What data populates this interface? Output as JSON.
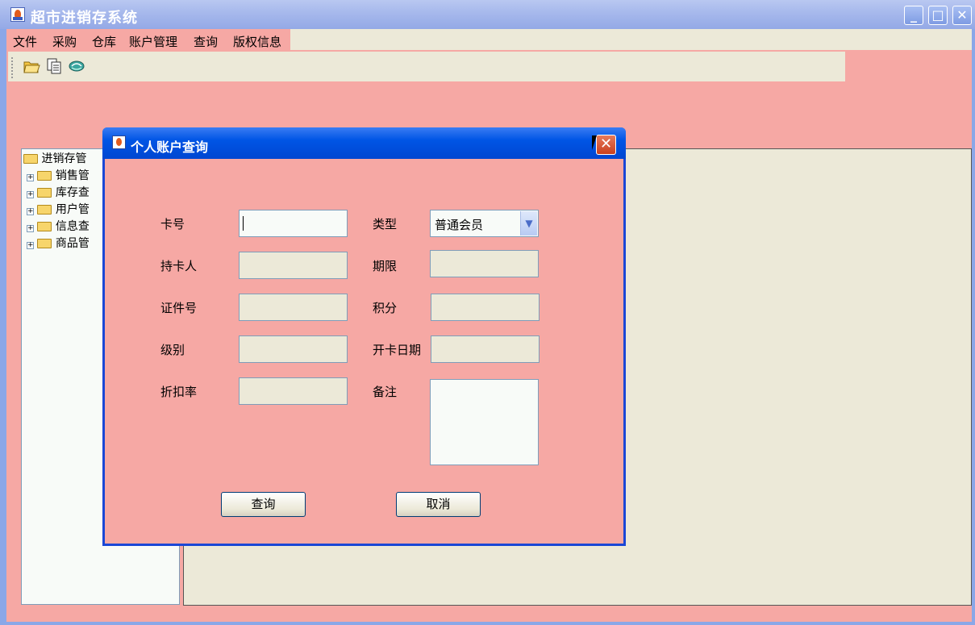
{
  "window": {
    "title": "超市进销存系统",
    "minimize_glyph": "_",
    "maximize_glyph": "□",
    "close_glyph": "✕"
  },
  "menu": {
    "items": [
      {
        "label": "文件"
      },
      {
        "label": "采购"
      },
      {
        "label": "仓库"
      },
      {
        "label": "账户管理"
      },
      {
        "label": "查询"
      },
      {
        "label": "版权信息"
      }
    ]
  },
  "toolbar": {
    "icons": [
      "open-folder-icon",
      "copy-document-icon",
      "refresh-book-icon"
    ]
  },
  "tree": {
    "root": "进销存管",
    "children": [
      "销售管",
      "库存查",
      "用户管",
      "信息查",
      "商品管"
    ]
  },
  "dialog": {
    "title": "个人账户查询",
    "close_glyph": "✕",
    "fields": {
      "card_no": {
        "label": "卡号",
        "value": ""
      },
      "type": {
        "label": "类型",
        "value": "普通会员"
      },
      "holder": {
        "label": "持卡人",
        "value": ""
      },
      "term": {
        "label": "期限",
        "value": ""
      },
      "id_no": {
        "label": "证件号",
        "value": ""
      },
      "points": {
        "label": "积分",
        "value": ""
      },
      "level": {
        "label": "级别",
        "value": ""
      },
      "open_date": {
        "label": "开卡日期",
        "value": ""
      },
      "discount": {
        "label": "折扣率",
        "value": ""
      },
      "remark": {
        "label": "备注",
        "value": ""
      }
    },
    "buttons": {
      "query": "查询",
      "cancel": "取消"
    }
  },
  "colors": {
    "background": "#f6a8a4",
    "panel": "#ece9d8",
    "dialog_titlebar": "#0055e5",
    "window_titlebar": "#a6b8ec"
  }
}
